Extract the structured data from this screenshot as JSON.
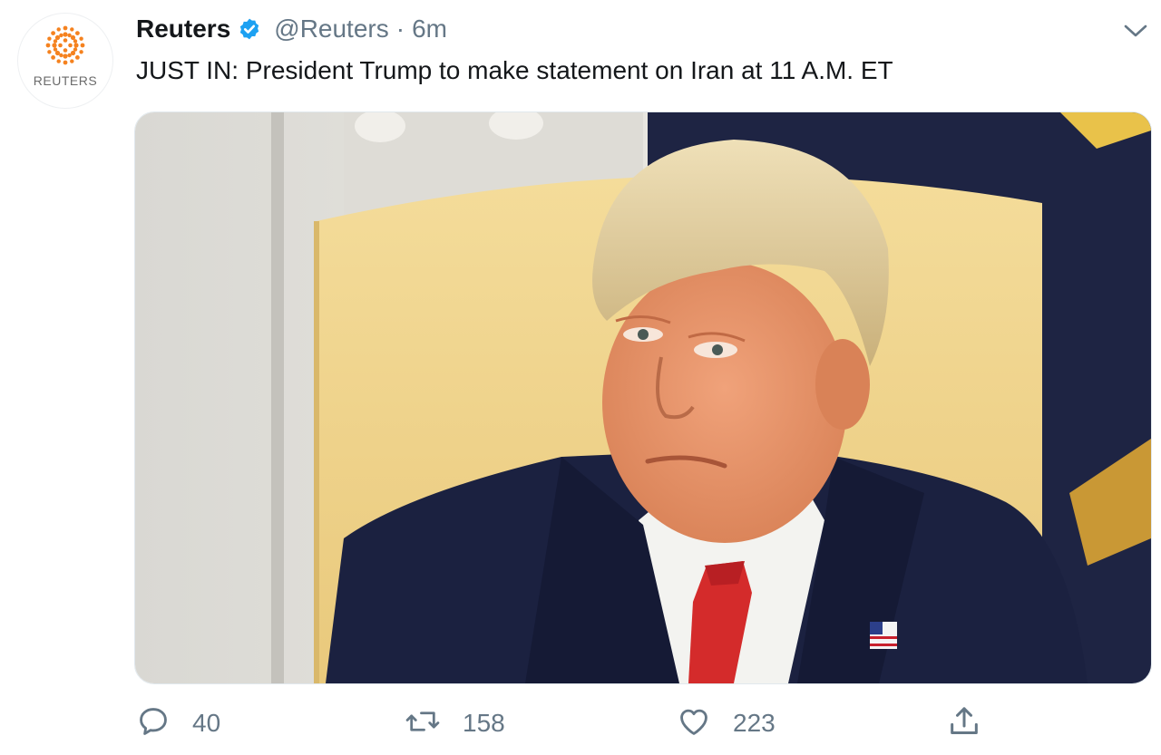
{
  "author": {
    "name": "Reuters",
    "handle": "@Reuters",
    "separator": "·",
    "time": "6m",
    "avatar_wordmark": "REUTERS",
    "verified": true,
    "avatar_icon": "reuters-logo-icon"
  },
  "tweet": {
    "text": "JUST IN: President Trump to make statement on Iran at 11 A.M. ET"
  },
  "actions": {
    "reply_count": "40",
    "retweet_count": "158",
    "like_count": "223"
  },
  "icons": {
    "reply": "reply-icon",
    "retweet": "retweet-icon",
    "like": "heart-icon",
    "share": "share-icon",
    "menu": "chevron-down-icon",
    "verified": "verified-badge-icon"
  },
  "colors": {
    "verified_blue": "#1da1f2",
    "secondary_text": "#657786",
    "primary_text": "#14171a",
    "brand_orange": "#f5821f"
  }
}
